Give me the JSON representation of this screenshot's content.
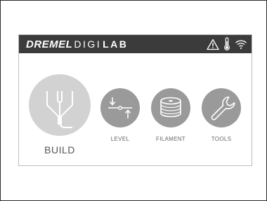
{
  "header": {
    "brand_part1": "DREMEL",
    "brand_part2": "DIGI",
    "brand_part3": "LAB",
    "status_icons": [
      "warning-icon",
      "thermometer-icon",
      "wifi-icon"
    ]
  },
  "menu": {
    "build": {
      "label": "BUILD",
      "icon": "build-nozzle-icon"
    },
    "level": {
      "label": "LEVEL",
      "icon": "level-icon"
    },
    "filament": {
      "label": "FILAMENT",
      "icon": "filament-spool-icon"
    },
    "tools": {
      "label": "TOOLS",
      "icon": "wrench-icon"
    }
  },
  "colors": {
    "topbar": "#3b3b3b",
    "circle": "#9a9a9a",
    "build_circle": "#d2d2d2",
    "label": "#666666"
  }
}
